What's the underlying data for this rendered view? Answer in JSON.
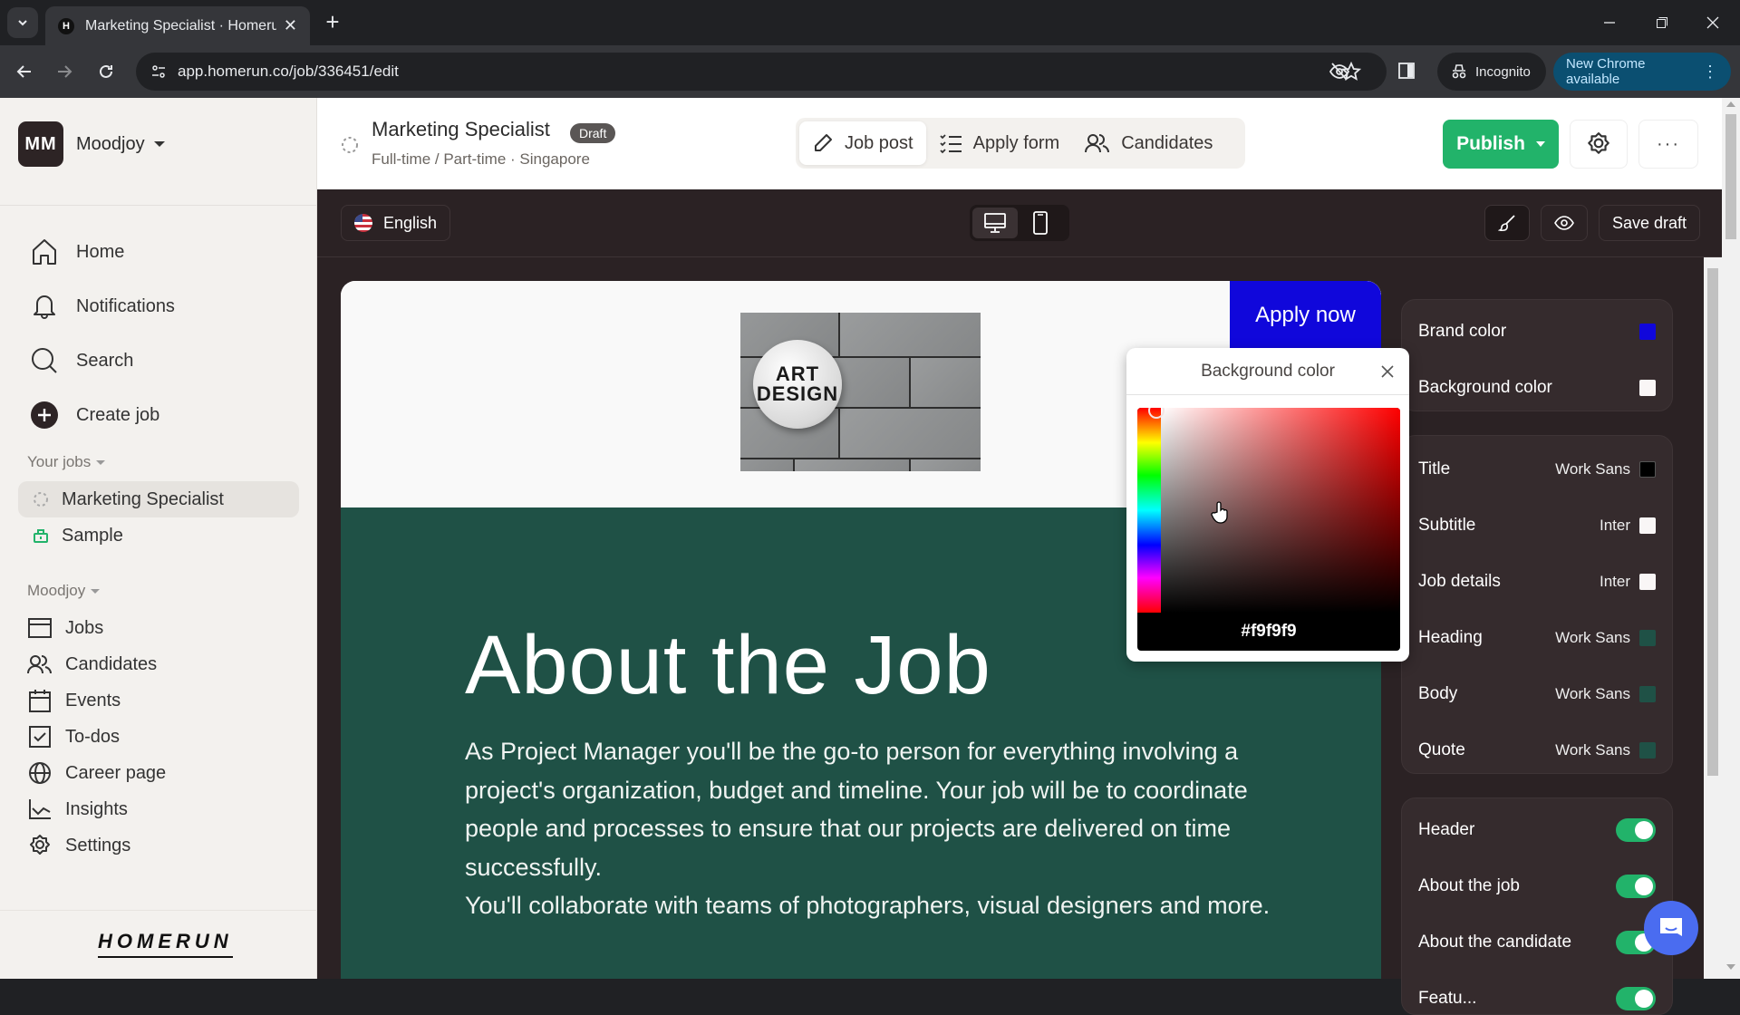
{
  "browser": {
    "tab_title": "Marketing Specialist · Homerun",
    "favicon_letter": "H",
    "url": "app.homerun.co/job/336451/edit",
    "incognito_label": "Incognito",
    "update_label": "New Chrome available"
  },
  "sidebar": {
    "workspace_initials": "MM",
    "workspace_name": "Moodjoy",
    "main_nav": [
      {
        "label": "Home",
        "icon": "home-icon"
      },
      {
        "label": "Notifications",
        "icon": "bell-icon"
      },
      {
        "label": "Search",
        "icon": "search-icon"
      },
      {
        "label": "Create job",
        "icon": "plus-circle-icon"
      }
    ],
    "your_jobs_label": "Your jobs",
    "jobs": [
      {
        "label": "Marketing Specialist",
        "status": "draft",
        "active": true
      },
      {
        "label": "Sample",
        "status": "published",
        "active": false
      }
    ],
    "org_label": "Moodjoy",
    "org_nav": [
      {
        "label": "Jobs",
        "icon": "browser-window-icon"
      },
      {
        "label": "Candidates",
        "icon": "users-icon"
      },
      {
        "label": "Events",
        "icon": "calendar-icon"
      },
      {
        "label": "To-dos",
        "icon": "checkbox-icon"
      },
      {
        "label": "Career page",
        "icon": "globe-icon"
      },
      {
        "label": "Insights",
        "icon": "chart-line-icon"
      },
      {
        "label": "Settings",
        "icon": "gear-icon"
      }
    ],
    "logo_text": "HOMERUN"
  },
  "header": {
    "job_title": "Marketing Specialist",
    "status_badge": "Draft",
    "job_meta": "Full-time / Part-time · Singapore",
    "tabs": [
      {
        "label": "Job post",
        "active": true
      },
      {
        "label": "Apply form",
        "active": false
      },
      {
        "label": "Candidates",
        "active": false
      }
    ],
    "publish_label": "Publish",
    "more_label": "···"
  },
  "editor": {
    "language": "English",
    "device_modes": [
      "desktop",
      "mobile"
    ],
    "active_device": "desktop",
    "save_draft_label": "Save draft"
  },
  "preview": {
    "logo_text_line1": "ART",
    "logo_text_line2": "DESIGN",
    "apply_label": "Apply now",
    "about_heading": "About the Job",
    "about_body_1": "As Project Manager you'll be the go-to person for everything involving a project's organization, budget and timeline. Your job will be to coordinate people and processes to ensure that our projects are delivered on time successfully.",
    "about_body_2": "You'll collaborate with teams of photographers, visual designers and more."
  },
  "color_picker": {
    "title": "Background color",
    "hex_value": "#f9f9f9",
    "hue_color": "#ff0000"
  },
  "style_panel": {
    "colors": [
      {
        "label": "Brand color",
        "swatch": "#1007db"
      },
      {
        "label": "Background color",
        "swatch": "#f9f6f6"
      }
    ],
    "typography": [
      {
        "label": "Title",
        "font": "Work Sans",
        "swatch": "#000000"
      },
      {
        "label": "Subtitle",
        "font": "Inter",
        "swatch": "#f9f6f6"
      },
      {
        "label": "Job details",
        "font": "Inter",
        "swatch": "#f9f6f6"
      },
      {
        "label": "Heading",
        "font": "Work Sans",
        "swatch": "#1f5146"
      },
      {
        "label": "Body",
        "font": "Work Sans",
        "swatch": "#1f5146"
      },
      {
        "label": "Quote",
        "font": "Work Sans",
        "swatch": "#1f5146"
      }
    ],
    "sections": [
      {
        "label": "Header",
        "enabled": true
      },
      {
        "label": "About the job",
        "enabled": true
      },
      {
        "label": "About the candidate",
        "enabled": true
      },
      {
        "label": "Featu...",
        "enabled": true
      }
    ]
  },
  "colors": {
    "brand": "#1007db",
    "publish_green": "#22b36a",
    "section_green": "#1f5146",
    "editor_bg": "#2b2224"
  }
}
